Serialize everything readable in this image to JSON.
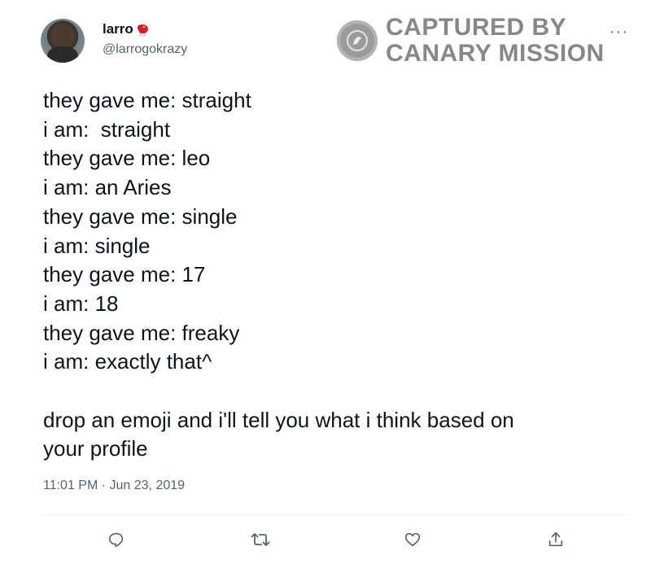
{
  "tweet": {
    "author_name": "larro",
    "author_emoji": "boxing-glove-emoji",
    "author_handle": "@larrogokrazy",
    "more_label": "···",
    "lines": [
      "they gave me: straight",
      "i am:  straight",
      "they gave me: leo",
      "i am: an Aries",
      "they gave me: single",
      "i am: single",
      "they gave me: 17",
      "i am: 18",
      "they gave me: freaky",
      "i am: exactly that^"
    ],
    "closing_lines": [
      "drop an emoji and i'll tell you what i think based on",
      "your profile"
    ],
    "timestamp": "11:01 PM · Jun 23, 2019"
  },
  "watermark": {
    "line1": "CAPTURED BY",
    "line2": "CANARY MISSION"
  },
  "actions": {
    "icons": [
      "reply-icon",
      "retweet-icon",
      "like-icon",
      "share-icon"
    ]
  },
  "colors": {
    "text": "#0f1419",
    "secondary": "#536471",
    "divider": "#eff3f4",
    "watermark": "#5f5f5f"
  }
}
